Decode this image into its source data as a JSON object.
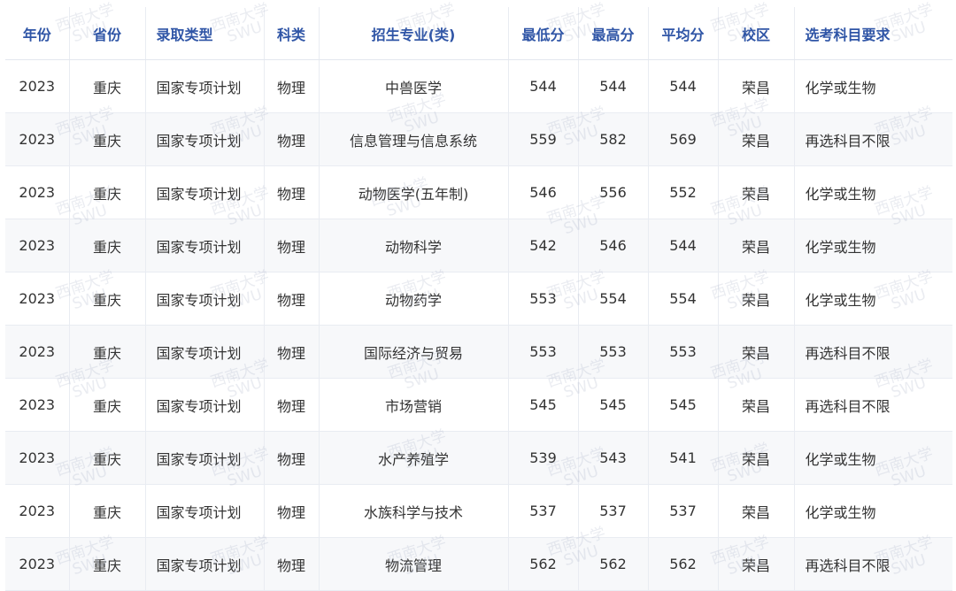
{
  "table": {
    "headers": [
      "年份",
      "省份",
      "录取类型",
      "科类",
      "招生专业(类)",
      "最低分",
      "最高分",
      "平均分",
      "校区",
      "选考科目要求"
    ],
    "rows": [
      [
        "2023",
        "重庆",
        "国家专项计划",
        "物理",
        "中兽医学",
        "544",
        "544",
        "544",
        "荣昌",
        "化学或生物"
      ],
      [
        "2023",
        "重庆",
        "国家专项计划",
        "物理",
        "信息管理与信息系统",
        "559",
        "582",
        "569",
        "荣昌",
        "再选科目不限"
      ],
      [
        "2023",
        "重庆",
        "国家专项计划",
        "物理",
        "动物医学(五年制)",
        "546",
        "556",
        "552",
        "荣昌",
        "化学或生物"
      ],
      [
        "2023",
        "重庆",
        "国家专项计划",
        "物理",
        "动物科学",
        "542",
        "546",
        "544",
        "荣昌",
        "化学或生物"
      ],
      [
        "2023",
        "重庆",
        "国家专项计划",
        "物理",
        "动物药学",
        "553",
        "554",
        "554",
        "荣昌",
        "化学或生物"
      ],
      [
        "2023",
        "重庆",
        "国家专项计划",
        "物理",
        "国际经济与贸易",
        "553",
        "553",
        "553",
        "荣昌",
        "再选科目不限"
      ],
      [
        "2023",
        "重庆",
        "国家专项计划",
        "物理",
        "市场营销",
        "545",
        "545",
        "545",
        "荣昌",
        "再选科目不限"
      ],
      [
        "2023",
        "重庆",
        "国家专项计划",
        "物理",
        "水产养殖学",
        "539",
        "543",
        "541",
        "荣昌",
        "化学或生物"
      ],
      [
        "2023",
        "重庆",
        "国家专项计划",
        "物理",
        "水族科学与技术",
        "537",
        "537",
        "537",
        "荣昌",
        "化学或生物"
      ],
      [
        "2023",
        "重庆",
        "国家专项计划",
        "物理",
        "物流管理",
        "562",
        "562",
        "562",
        "荣昌",
        "再选科目不限"
      ]
    ]
  },
  "watermark": {
    "line1": "西南大学",
    "line2": "SWU",
    "color": "#a0aabe"
  }
}
